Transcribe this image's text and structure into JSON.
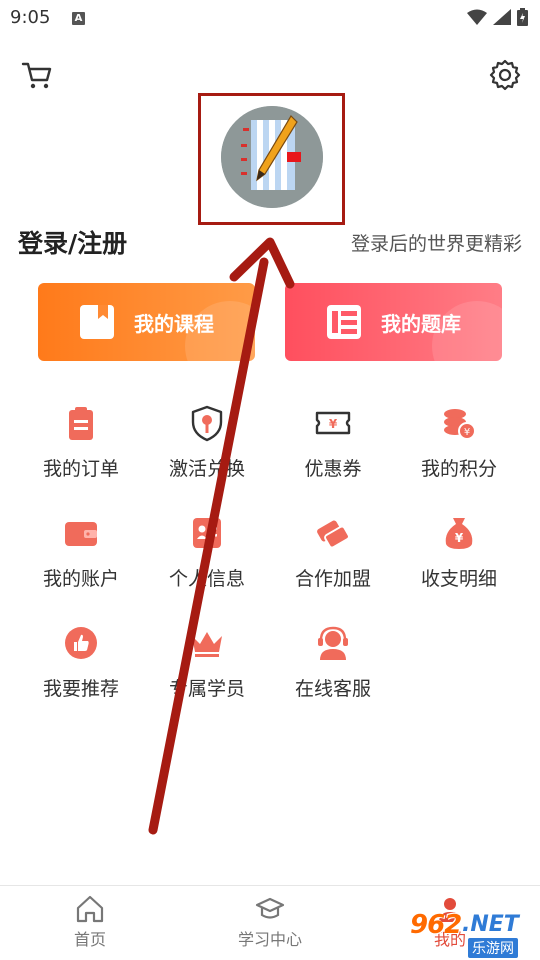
{
  "status": {
    "time": "9:05",
    "a_badge": "A"
  },
  "header": {
    "cart_icon": "cart-icon",
    "settings_icon": "gear-icon"
  },
  "profile": {
    "avatar_icon": "notebook-pencil-icon",
    "login_title": "登录/注册",
    "login_subtitle": "登录后的世界更精彩"
  },
  "primary_buttons": [
    {
      "label": "我的课程",
      "icon": "book-icon",
      "color": "#ff7a1a"
    },
    {
      "label": "我的题库",
      "icon": "list-icon",
      "color": "#ff4f5e"
    }
  ],
  "menu": [
    {
      "label": "我的订单",
      "icon": "clipboard-icon"
    },
    {
      "label": "激活兑换",
      "icon": "key-shield-icon"
    },
    {
      "label": "优惠券",
      "icon": "ticket-icon"
    },
    {
      "label": "我的积分",
      "icon": "coins-icon"
    },
    {
      "label": "我的账户",
      "icon": "wallet-icon"
    },
    {
      "label": "个人信息",
      "icon": "id-card-icon"
    },
    {
      "label": "合作加盟",
      "icon": "handshake-icon"
    },
    {
      "label": "收支明细",
      "icon": "money-bag-icon"
    },
    {
      "label": "我要推荐",
      "icon": "thumbs-up-icon"
    },
    {
      "label": "专属学员",
      "icon": "crown-icon"
    },
    {
      "label": "在线客服",
      "icon": "headset-icon"
    }
  ],
  "tabbar": [
    {
      "label": "首页",
      "icon": "home-icon"
    },
    {
      "label": "学习中心",
      "icon": "graduation-cap-icon"
    },
    {
      "label": "我的",
      "icon": "user-icon"
    }
  ],
  "watermark": {
    "num": "962",
    "net": ".NET",
    "cn": "乐游网"
  },
  "accent_color": "#f06b5b"
}
